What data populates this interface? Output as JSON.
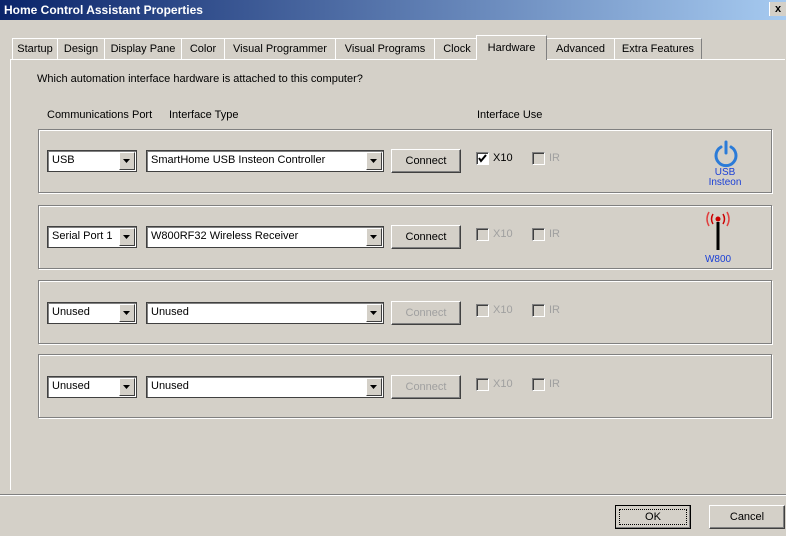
{
  "window": {
    "title": "Home Control Assistant Properties",
    "close_label": "x"
  },
  "tabs": [
    {
      "label": "Startup"
    },
    {
      "label": "Design"
    },
    {
      "label": "Display Pane"
    },
    {
      "label": "Color"
    },
    {
      "label": "Visual Programmer"
    },
    {
      "label": "Visual Programs"
    },
    {
      "label": "Clock"
    },
    {
      "label": "Hardware",
      "active": true
    },
    {
      "label": "Advanced"
    },
    {
      "label": "Extra Features"
    }
  ],
  "hardware": {
    "question": "Which automation interface hardware is attached to this computer?",
    "col_port": "Communications Port",
    "col_type": "Interface Type",
    "col_use": "Interface Use",
    "rows": [
      {
        "port": "USB",
        "type": "SmartHome USB Insteon Controller",
        "connect": "Connect",
        "connect_enabled": true,
        "x10_label": "X10",
        "x10_checked": true,
        "x10_enabled": true,
        "ir_label": "IR",
        "ir_checked": false,
        "ir_enabled": false,
        "icon": "power-icon",
        "icon_label_1": "USB",
        "icon_label_2": "Insteon"
      },
      {
        "port": "Serial Port 1",
        "type": "W800RF32 Wireless Receiver",
        "connect": "Connect",
        "connect_enabled": true,
        "x10_label": "X10",
        "x10_checked": false,
        "x10_enabled": false,
        "ir_label": "IR",
        "ir_checked": false,
        "ir_enabled": false,
        "icon": "antenna-icon",
        "icon_label_1": "W800"
      },
      {
        "port": "Unused",
        "type": "Unused",
        "connect": "Connect",
        "connect_enabled": false,
        "x10_label": "X10",
        "x10_checked": false,
        "x10_enabled": false,
        "ir_label": "IR",
        "ir_checked": false,
        "ir_enabled": false
      },
      {
        "port": "Unused",
        "type": "Unused",
        "connect": "Connect",
        "connect_enabled": false,
        "x10_label": "X10",
        "x10_checked": false,
        "x10_enabled": false,
        "ir_label": "IR",
        "ir_checked": false,
        "ir_enabled": false
      }
    ]
  },
  "footer": {
    "ok_label": "OK",
    "cancel_label": "Cancel"
  },
  "colors": {
    "title_start": "#0a246a",
    "title_end": "#a6caf0",
    "face": "#d4d0c8",
    "icon_blue": "#1a3fd6",
    "icon_red": "#cc0000"
  }
}
